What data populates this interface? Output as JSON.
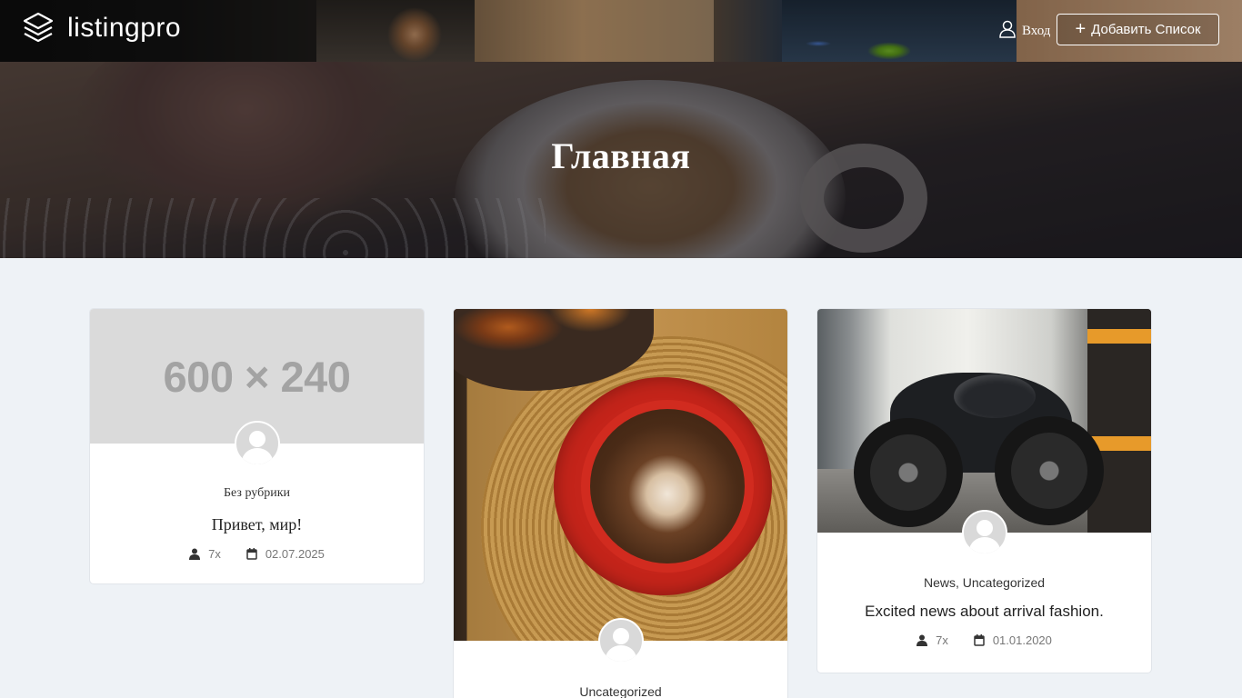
{
  "header": {
    "logo_text": "listingpro",
    "login_label": "Вход",
    "add_listing_label": "Добавить Список"
  },
  "hero": {
    "title": "Главная"
  },
  "posts": [
    {
      "image_placeholder": "600 × 240",
      "category": "Без рубрики",
      "title": "Привет, мир!",
      "views": "7x",
      "date": "02.07.2025"
    },
    {
      "category": "Uncategorized"
    },
    {
      "category": "News, Uncategorized",
      "title": "Excited news about arrival fashion.",
      "views": "7x",
      "date": "01.01.2020"
    }
  ],
  "colors": {
    "page_background": "#eef2f6",
    "card_background": "#ffffff",
    "hero_text": "#ffffff"
  },
  "icons": [
    "layers-logo-icon",
    "user-icon",
    "plus-icon",
    "author-icon",
    "calendar-icon"
  ]
}
